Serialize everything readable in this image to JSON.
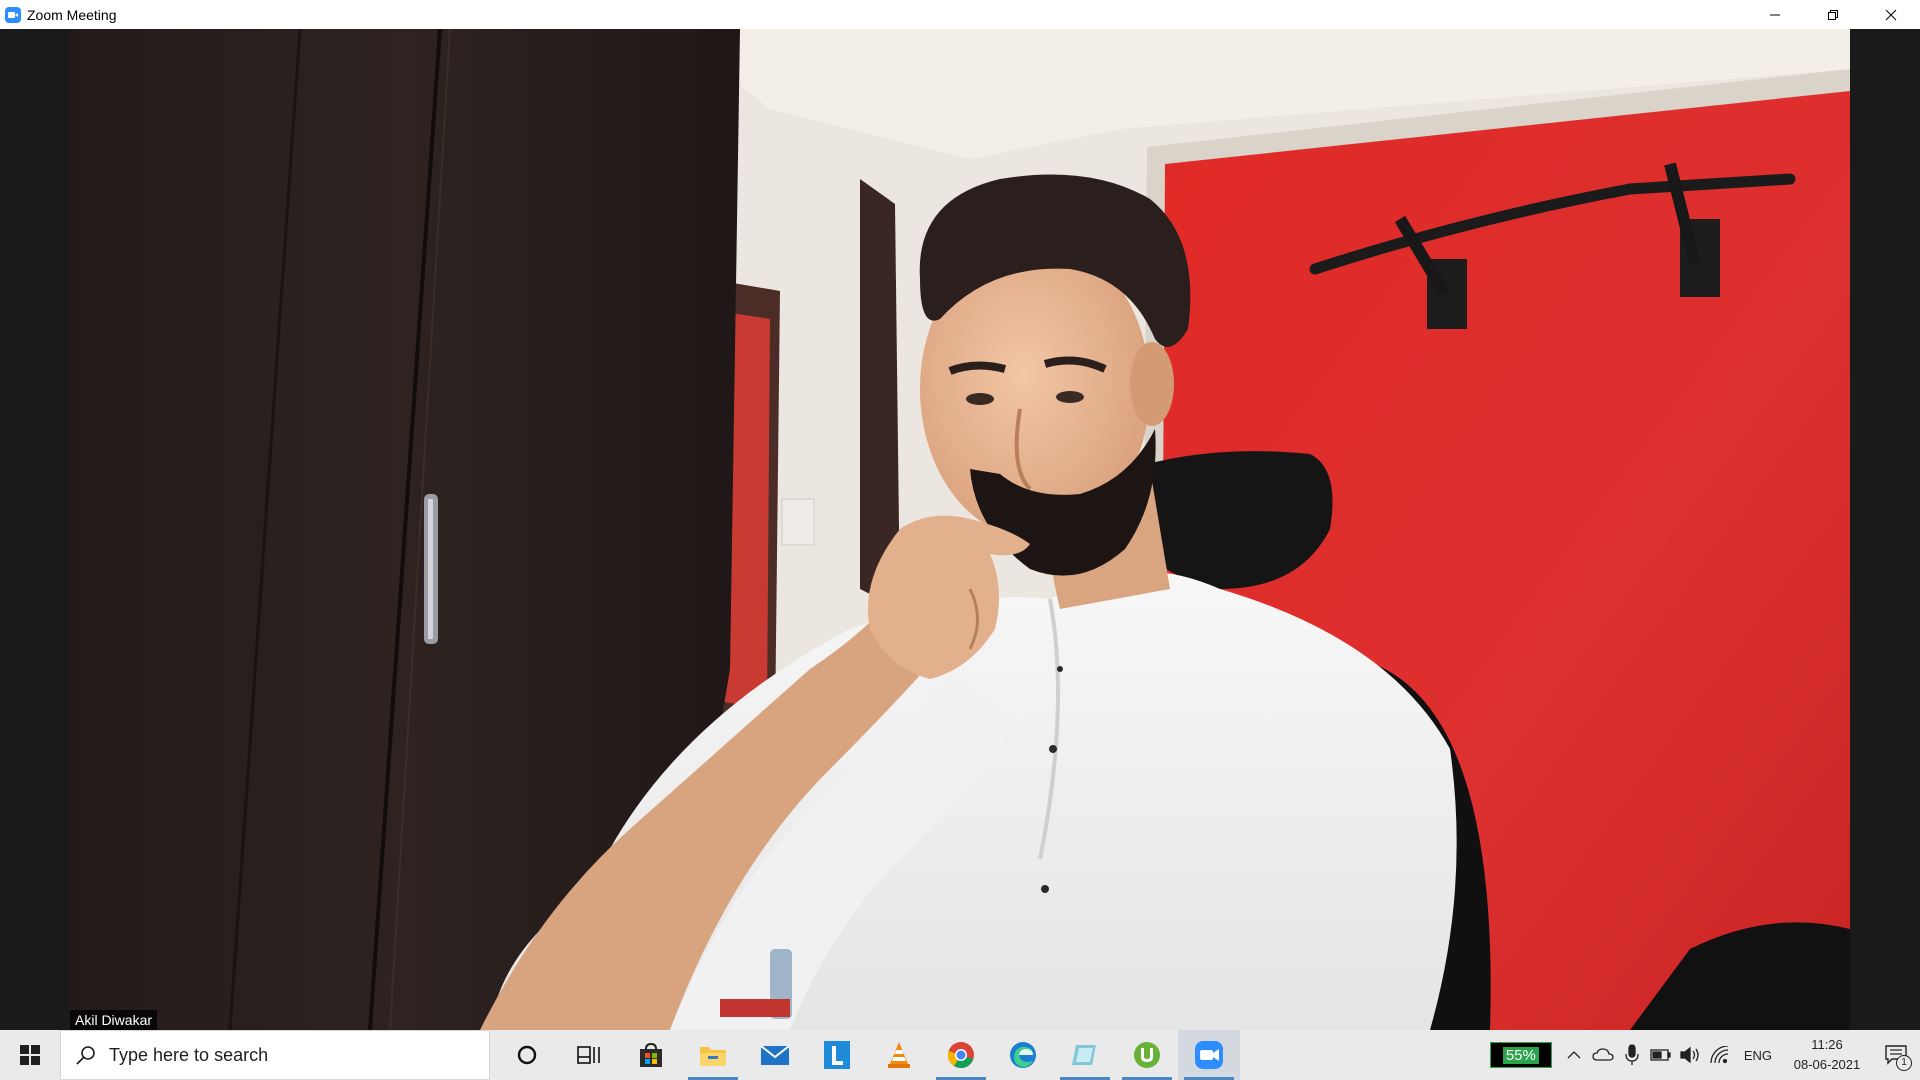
{
  "window": {
    "title": "Zoom Meeting",
    "icon": "zoom-camera-icon",
    "controls": [
      "minimize-icon",
      "restore-icon",
      "close-icon"
    ]
  },
  "meeting": {
    "participant_name": "Akil Diwakar"
  },
  "taskbar": {
    "search_placeholder": "Type here to search",
    "pinned_apps": [
      {
        "name": "cortana",
        "icon": "circle-icon",
        "active": false
      },
      {
        "name": "task-view",
        "icon": "task-view-icon",
        "active": false
      },
      {
        "name": "microsoft-store",
        "icon": "store-bag-icon",
        "active": false
      },
      {
        "name": "file-explorer",
        "icon": "folder-icon",
        "active": true
      },
      {
        "name": "mail",
        "icon": "mail-icon",
        "active": false
      },
      {
        "name": "l-app",
        "icon": "letter-l-icon",
        "active": false
      },
      {
        "name": "vlc",
        "icon": "traffic-cone-icon",
        "active": false
      },
      {
        "name": "chrome",
        "icon": "chrome-icon",
        "active": true
      },
      {
        "name": "edge",
        "icon": "edge-icon",
        "active": false
      },
      {
        "name": "notes-app",
        "icon": "notes-icon",
        "active": true
      },
      {
        "name": "utorrent",
        "icon": "utorrent-icon",
        "active": true
      },
      {
        "name": "zoom",
        "icon": "zoom-camera-icon",
        "active": true
      }
    ],
    "tray": {
      "battery_percent": "55%",
      "language": "ENG",
      "time": "11:26",
      "date": "08-06-2021",
      "notification_count": "1"
    }
  },
  "colors": {
    "zoom_blue": "#2d8cff",
    "wall_red": "#dd2a2a",
    "taskbar_bg": "#eaeaea",
    "active_indicator": "#4a88c7",
    "battery_green": "#2aa34a"
  }
}
